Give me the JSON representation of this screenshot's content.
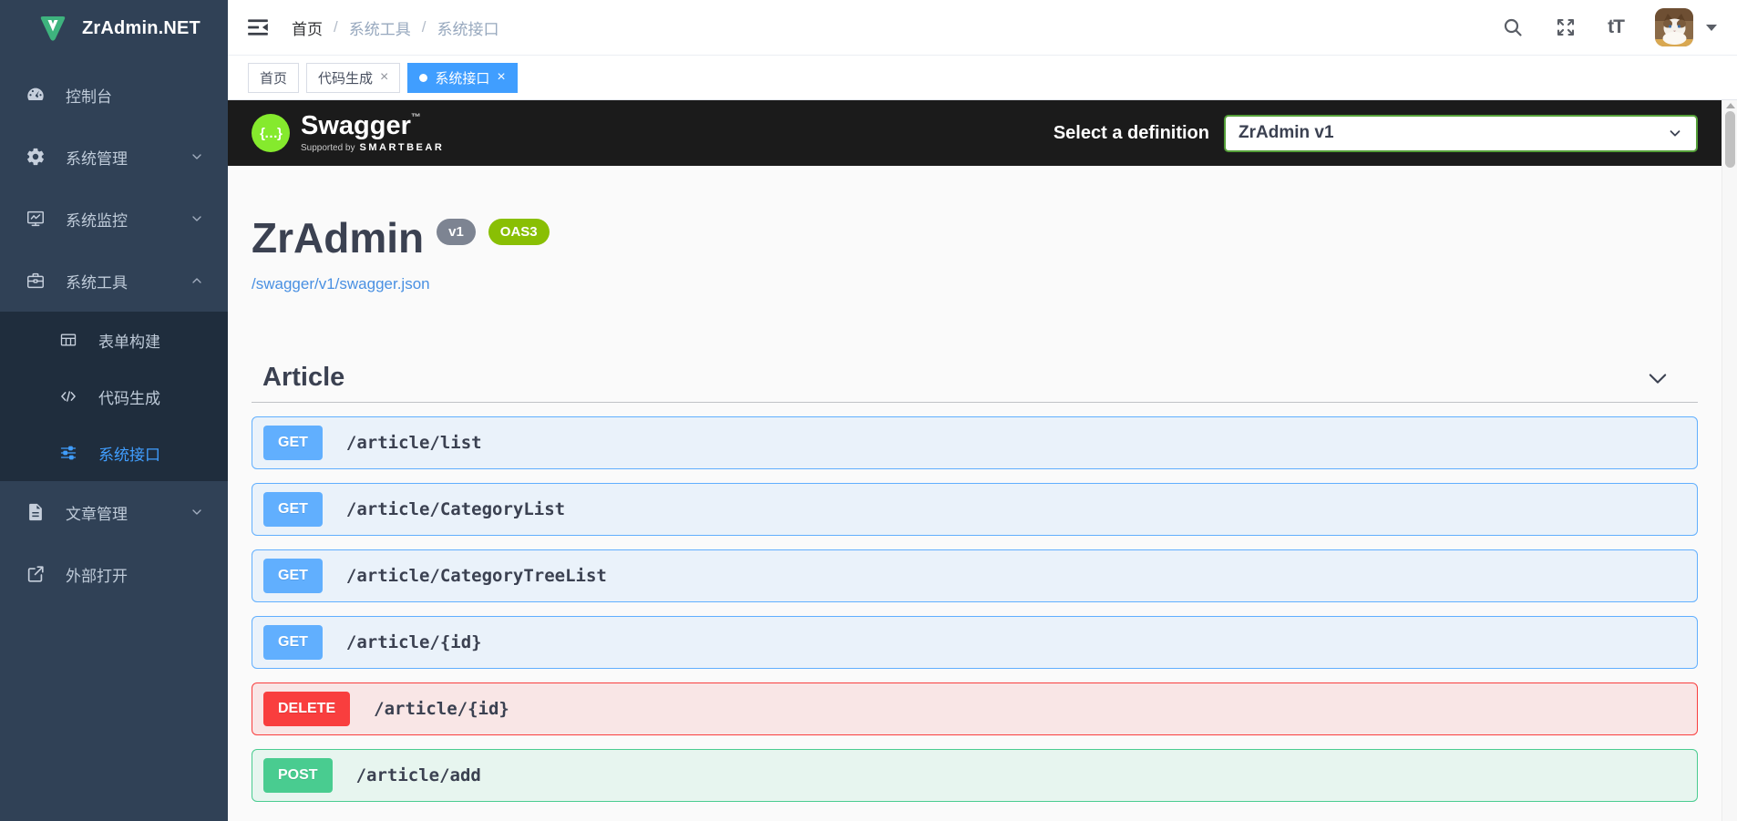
{
  "app": {
    "name": "ZrAdmin.NET"
  },
  "sidebar": {
    "items": [
      {
        "label": "控制台"
      },
      {
        "label": "系统管理"
      },
      {
        "label": "系统监控"
      },
      {
        "label": "系统工具"
      },
      {
        "label": "表单构建"
      },
      {
        "label": "代码生成"
      },
      {
        "label": "系统接口"
      },
      {
        "label": "文章管理"
      },
      {
        "label": "外部打开"
      }
    ]
  },
  "breadcrumb": {
    "separator": "/",
    "items": [
      {
        "label": "首页"
      },
      {
        "label": "系统工具"
      },
      {
        "label": "系统接口"
      }
    ]
  },
  "tabs": [
    {
      "label": "首页"
    },
    {
      "label": "代码生成",
      "close": "×"
    },
    {
      "label": "系统接口",
      "close": "×"
    }
  ],
  "navbar": {
    "text_size_glyph": "tT"
  },
  "swagger": {
    "logo_glyph": "{…}",
    "brand": "Swagger",
    "trademark": "™",
    "supported_by": "Supported by",
    "smartbear": "SMARTBEAR",
    "definition_label": "Select a definition",
    "definition_value": "ZrAdmin v1",
    "api_title": "ZrAdmin",
    "api_version": "v1",
    "oas_badge": "OAS3",
    "spec_link": "/swagger/v1/swagger.json",
    "section_title": "Article",
    "endpoints": [
      {
        "method": "GET",
        "path": "/article/list"
      },
      {
        "method": "GET",
        "path": "/article/CategoryList"
      },
      {
        "method": "GET",
        "path": "/article/CategoryTreeList"
      },
      {
        "method": "GET",
        "path": "/article/{id}"
      },
      {
        "method": "DELETE",
        "path": "/article/{id}"
      },
      {
        "method": "POST",
        "path": "/article/add"
      }
    ],
    "colors": {
      "get": "#61affe",
      "post": "#49cc90",
      "delete": "#f93e3e",
      "topbar": "#1b1b1b",
      "brand_green": "#85ea2d",
      "select_border": "#549f38"
    }
  },
  "theme": {
    "sidebar_bg": "#304156",
    "submenu_bg": "#1f2d3d",
    "active_blue": "#409eff",
    "content_bg": "#fafafa"
  }
}
